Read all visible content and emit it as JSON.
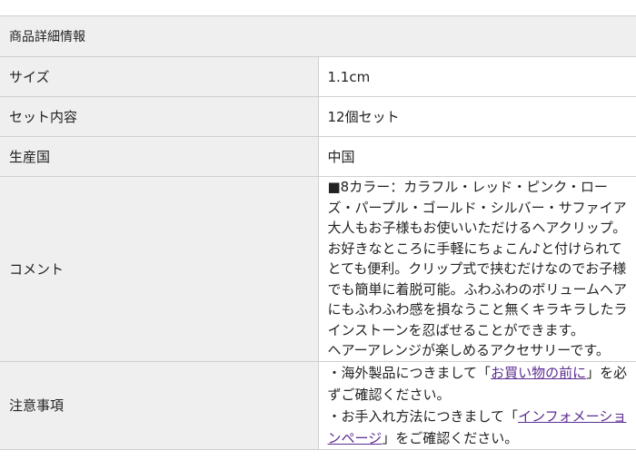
{
  "title": "商品詳細情報",
  "rows": {
    "size": {
      "label": "サイズ",
      "value": "1.1cm"
    },
    "set": {
      "label": "セット内容",
      "value": "12個セット"
    },
    "origin": {
      "label": "生産国",
      "value": "中国"
    },
    "comment": {
      "label": "コメント",
      "colors": "■8カラー：カラフル・レッド・ピンク・ローズ・パープル・ゴールド・シルバー・サファイア",
      "description": "大人もお子様もお使いいただけるヘアクリップ。お好きなところに手軽にちょこん♪と付けられてとても便利。クリップ式で挟むだけなのでお子様でも簡単に着脱可能。ふわふわのボリュームヘアにもふわふわ感を損なうこと無くキラキラしたラインストーンを忍ばせることができます。",
      "closing": "ヘアーアレンジが楽しめるアクセサリーです。"
    },
    "notes": {
      "label": "注意事項",
      "note1_prefix": "・海外製品につきまして「",
      "note1_link": "お買い物の前に",
      "note1_suffix": "」を必ずご確認ください。",
      "note2_prefix": "・お手入れ方法につきまして「",
      "note2_link": "インフォメーションページ",
      "note2_suffix": "」をご確認ください。"
    }
  },
  "colors": {
    "header_bg": "#efefef",
    "border": "#cfcfcf",
    "link": "#5b2d91",
    "text": "#222222"
  }
}
